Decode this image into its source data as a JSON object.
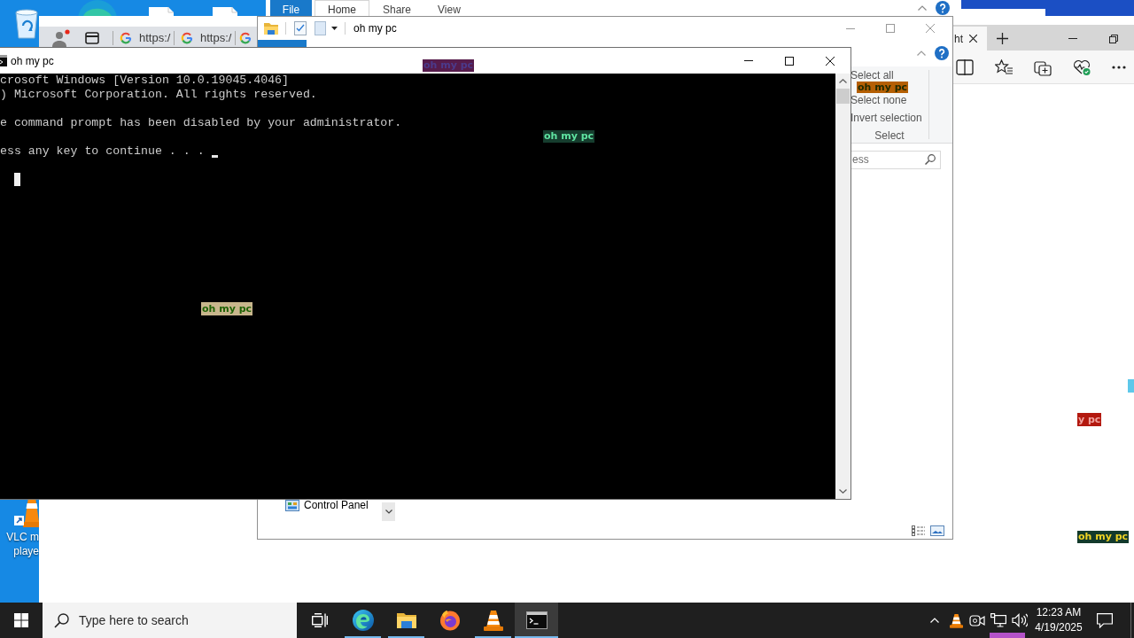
{
  "desktop": {
    "shortcut_label": [
      "VLC m",
      "playe"
    ]
  },
  "back_explorer": {
    "ribbon_tabs": [
      {
        "label": "File",
        "kind": "menu",
        "selected": false
      },
      {
        "label": "Home",
        "kind": "tab",
        "selected": true
      },
      {
        "label": "Share",
        "kind": "tab",
        "selected": false
      },
      {
        "label": "View",
        "kind": "tab",
        "selected": false
      }
    ]
  },
  "browser": {
    "tabs": [
      {
        "title": "https:/"
      },
      {
        "title": "https:/"
      }
    ]
  },
  "edge": {
    "tabs": [
      {
        "title": "ht",
        "selected": true
      }
    ]
  },
  "explorer": {
    "title": "oh my pc",
    "ribbon_group": {
      "label": "Select",
      "items": [
        "Select all",
        "Select none",
        "Invert selection"
      ]
    },
    "search": {
      "placeholder": "ess"
    },
    "navigation": [
      "Control Panel"
    ]
  },
  "console": {
    "title": "oh my pc",
    "paragraphs": [
      [
        "crosoft Windows [Version 10.0.19045.4046]",
        ") Microsoft Corporation. All rights reserved."
      ],
      [
        "e command prompt has been disabled by your administrator."
      ],
      [
        "ess any key to continue . . ."
      ]
    ]
  },
  "overlay_labels": [
    {
      "text": "oh my pc",
      "color": "#561c4c"
    },
    {
      "text": "oh my pc",
      "color": "#b45f04"
    },
    {
      "text": "oh my pc",
      "color": "#163d2e"
    },
    {
      "text": "oh my pc",
      "color": "#c8b68c"
    },
    {
      "color": "#5ec8ea"
    },
    {
      "text": "y pc",
      "color": "#b3190f"
    },
    {
      "text": "oh my pc",
      "color": "#133a2b"
    },
    {
      "color": "#b452c8"
    }
  ],
  "taskbar": {
    "search": {
      "placeholder": "Type here to search"
    },
    "apps": [
      {
        "running": true,
        "active": false
      },
      {
        "running": true,
        "active": false
      },
      {
        "running": false,
        "active": false
      },
      {
        "running": true,
        "active": false
      },
      {
        "running": true,
        "active": true
      }
    ],
    "clock": {
      "time": "12:23 AM",
      "date": "4/19/2025"
    }
  }
}
